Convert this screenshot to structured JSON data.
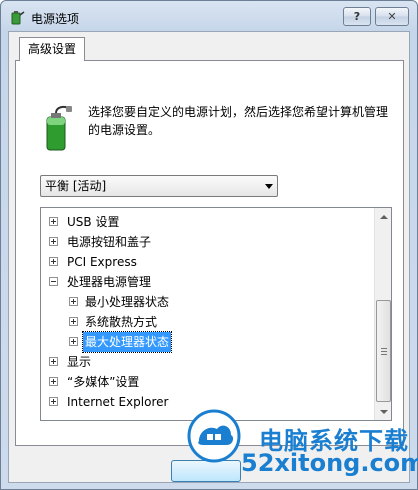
{
  "window": {
    "title": "电源选项",
    "help_label": "?",
    "close_label": "✕"
  },
  "tab": {
    "label": "高级设置"
  },
  "description": "选择您要自定义的电源计划，然后选择您希望计算机管理的电源设置。",
  "plan_select": {
    "value": "平衡 [活动]"
  },
  "tree": {
    "items": [
      {
        "label": "USB 设置",
        "expander": "plus"
      },
      {
        "label": "电源按钮和盖子",
        "expander": "plus"
      },
      {
        "label": "PCI Express",
        "expander": "plus"
      },
      {
        "label": "处理器电源管理",
        "expander": "minus"
      },
      {
        "label": "最小处理器状态",
        "expander": "plus"
      },
      {
        "label": "系统散热方式",
        "expander": "plus"
      },
      {
        "label": "最大处理器状态",
        "expander": "plus",
        "selected": true
      },
      {
        "label": "显示",
        "expander": "plus"
      },
      {
        "label": "“多媒体”设置",
        "expander": "plus"
      },
      {
        "label": "Internet Explorer",
        "expander": "plus"
      }
    ]
  },
  "watermark": {
    "line1": "电脑系统下载",
    "line2": "52xitong.com"
  },
  "colors": {
    "selection": "#3399ff",
    "watermark": "#1a7fd0"
  }
}
